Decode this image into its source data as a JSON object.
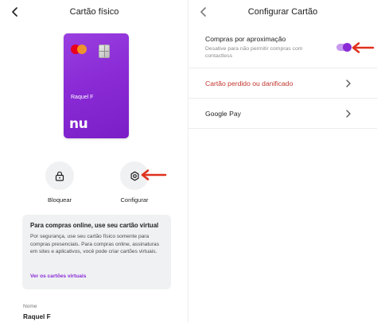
{
  "left": {
    "title": "Cartão físico",
    "card": {
      "holder": "Raquel F",
      "brand_logo": "nu"
    },
    "actions": [
      {
        "label": "Bloquear",
        "icon": "lock-icon"
      },
      {
        "label": "Configurar",
        "icon": "settings-icon"
      }
    ],
    "info": {
      "title": "Para compras online, use seu cartão virtual",
      "body": "Por segurança, use seu cartão físico somente para compras presenciais. Para compras online, assinaturas em sites e aplicativos, você pode criar cartões virtuais.",
      "link": "Ver os cartões virtuais"
    },
    "name_field": {
      "label": "Nome",
      "value": "Raquel F"
    }
  },
  "right": {
    "title": "Configurar Cartão",
    "items": [
      {
        "title": "Compras por aproximação",
        "subtitle": "Desative para não permitir compras com contactless",
        "toggle_on": true
      },
      {
        "title": "Cartão perdido ou danificado"
      },
      {
        "title": "Google Pay"
      }
    ]
  },
  "colors": {
    "accent": "#8a2bd6",
    "danger_text": "#c0362f",
    "annotation_arrow": "#e0301e"
  }
}
